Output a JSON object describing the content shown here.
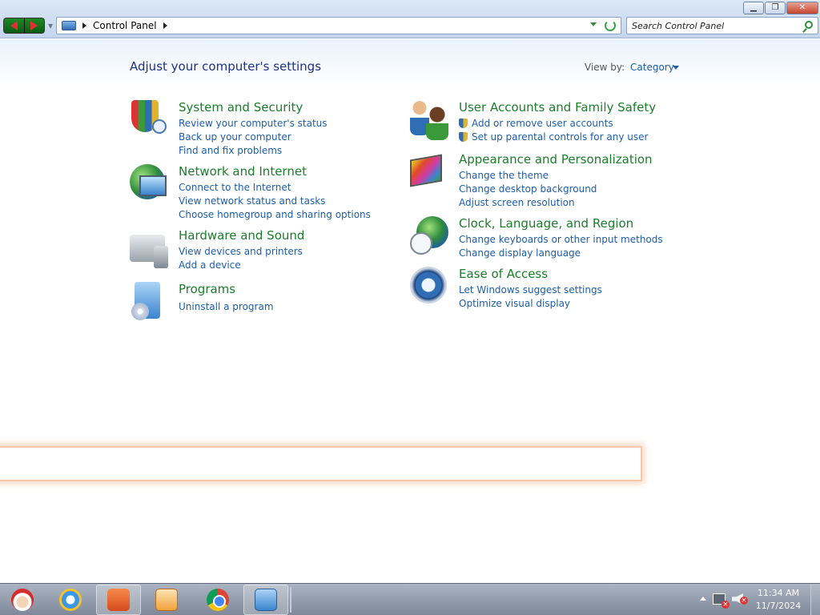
{
  "window": {
    "controls": {
      "minimize": "▁",
      "maximize": "❐",
      "close": "✕"
    }
  },
  "address": {
    "location": "Control Panel",
    "search_placeholder": "Search Control Panel"
  },
  "header": {
    "title": "Adjust your computer's settings",
    "view_by_label": "View by:",
    "view_by_value": "Category"
  },
  "categories": [
    {
      "title": "System and Security",
      "icon": "security-shield-icon",
      "links": [
        "Review your computer's status",
        "Back up your computer",
        "Find and fix problems"
      ]
    },
    {
      "title": "Network and Internet",
      "icon": "network-globe-icon",
      "links": [
        "Connect to the Internet",
        "View network status and tasks",
        "Choose homegroup and sharing options"
      ]
    },
    {
      "title": "Hardware and Sound",
      "icon": "printer-icon",
      "links": [
        "View devices and printers",
        "Add a device"
      ]
    },
    {
      "title": "Programs",
      "icon": "programs-icon",
      "links": [
        "Uninstall a program"
      ]
    },
    {
      "title": "User Accounts and Family Safety",
      "icon": "users-icon",
      "links": [
        "Add or remove user accounts",
        "Set up parental controls for any user"
      ]
    },
    {
      "title": "Appearance and Personalization",
      "icon": "palette-icon",
      "links": [
        "Change the theme",
        "Change desktop background",
        "Adjust screen resolution"
      ]
    },
    {
      "title": "Clock, Language, and Region",
      "icon": "clock-globe-icon",
      "links": [
        "Change keyboards or other input methods",
        "Change display language"
      ]
    },
    {
      "title": "Ease of Access",
      "icon": "ease-of-access-icon",
      "links": [
        "Let Windows suggest settings",
        "Optimize visual display"
      ]
    }
  ],
  "taskbar": {
    "apps": [
      "santa-start-icon",
      "internet-explorer-icon",
      "file-explorer-icon",
      "media-player-icon",
      "chrome-icon",
      "control-panel-icon"
    ],
    "time": "11:34 AM",
    "date": "11/7/2024"
  }
}
